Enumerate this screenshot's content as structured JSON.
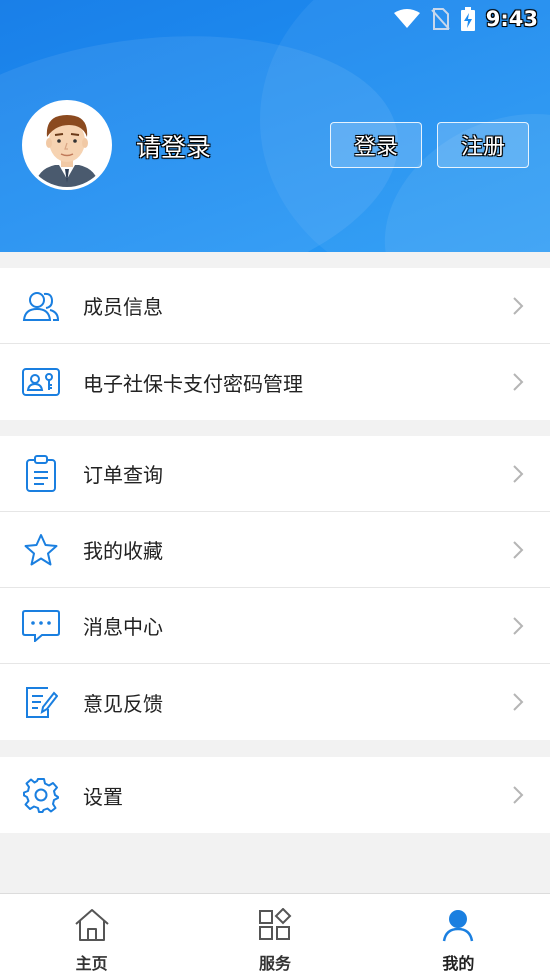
{
  "status_bar": {
    "time": "9:43",
    "icons": [
      "wifi-icon",
      "no-sim-icon",
      "battery-charging-icon"
    ]
  },
  "header": {
    "login_prompt": "请登录",
    "login_button": "登录",
    "register_button": "注册"
  },
  "menu_groups": [
    {
      "items": [
        {
          "label": "成员信息",
          "icon": "members-icon"
        },
        {
          "label": "电子社保卡支付密码管理",
          "icon": "social-card-icon"
        }
      ]
    },
    {
      "items": [
        {
          "label": "订单查询",
          "icon": "clipboard-icon"
        },
        {
          "label": "我的收藏",
          "icon": "star-icon"
        },
        {
          "label": "消息中心",
          "icon": "message-icon"
        },
        {
          "label": "意见反馈",
          "icon": "feedback-icon"
        }
      ]
    },
    {
      "items": [
        {
          "label": "设置",
          "icon": "gear-icon"
        }
      ]
    }
  ],
  "bottom_nav": {
    "items": [
      {
        "label": "主页",
        "icon": "home-icon"
      },
      {
        "label": "服务",
        "icon": "services-icon"
      },
      {
        "label": "我的",
        "icon": "user-icon",
        "active": true
      }
    ]
  },
  "colors": {
    "header": "#1d8cf0",
    "icon_blue": "#1a7fe0",
    "chevron": "#b5b5b5"
  }
}
